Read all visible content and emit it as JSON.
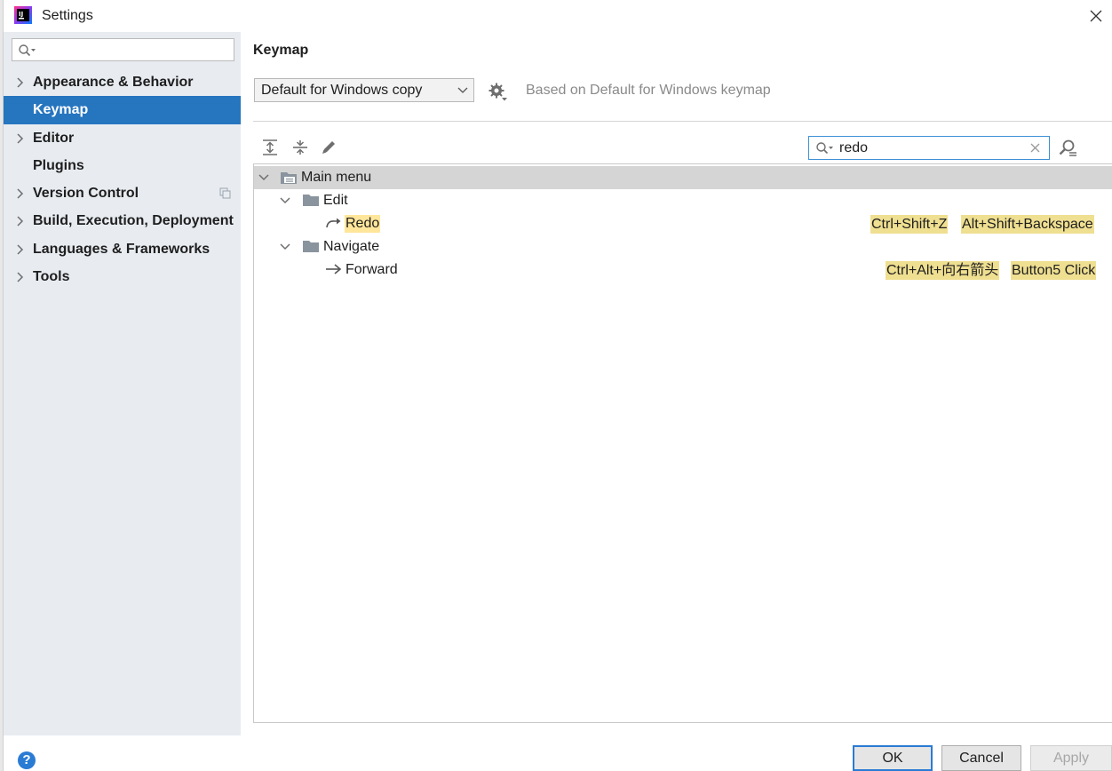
{
  "window": {
    "title": "Settings"
  },
  "sidebar": {
    "search": {
      "value": "",
      "placeholder": ""
    },
    "items": [
      {
        "label": "Appearance & Behavior",
        "expandable": true,
        "selected": false
      },
      {
        "label": "Keymap",
        "expandable": false,
        "selected": true
      },
      {
        "label": "Editor",
        "expandable": true,
        "selected": false
      },
      {
        "label": "Plugins",
        "expandable": false,
        "selected": false
      },
      {
        "label": "Version Control",
        "expandable": true,
        "selected": false
      },
      {
        "label": "Build, Execution, Deployment",
        "expandable": true,
        "selected": false
      },
      {
        "label": "Languages & Frameworks",
        "expandable": true,
        "selected": false
      },
      {
        "label": "Tools",
        "expandable": true,
        "selected": false
      }
    ]
  },
  "main": {
    "title": "Keymap",
    "keymap_select": {
      "value": "Default for Windows copy"
    },
    "based_on": "Based on Default for Windows keymap",
    "filter": {
      "value": "redo"
    },
    "tree": {
      "root": {
        "label": "Main menu"
      },
      "edit": {
        "label": "Edit"
      },
      "redo": {
        "label": "Redo",
        "shortcuts": [
          "Ctrl+Shift+Z",
          "Alt+Shift+Backspace"
        ]
      },
      "navigate": {
        "label": "Navigate"
      },
      "forward": {
        "label": "Forward",
        "shortcuts": [
          "Ctrl+Alt+向右箭头",
          "Button5 Click"
        ]
      }
    }
  },
  "footer": {
    "help_label": "?",
    "ok_label": "OK",
    "cancel_label": "Cancel",
    "apply_label": "Apply"
  },
  "colors": {
    "sidebar_bg": "#e8ecf1",
    "selection": "#2675bf",
    "shortcut_bg": "#efdf91",
    "match_bg": "#ffe69a",
    "focus_border": "#3d8fd6"
  },
  "icons": [
    "app-logo-icon",
    "close-icon",
    "search-icon",
    "chevron-right-icon",
    "chevron-down-icon",
    "copy-icon",
    "gear-icon",
    "expand-all-icon",
    "collapse-all-icon",
    "edit-icon",
    "clear-icon",
    "find-shortcut-icon",
    "folder-icon",
    "menu-folder-icon",
    "redo-icon",
    "forward-arrow-icon",
    "help-icon"
  ]
}
